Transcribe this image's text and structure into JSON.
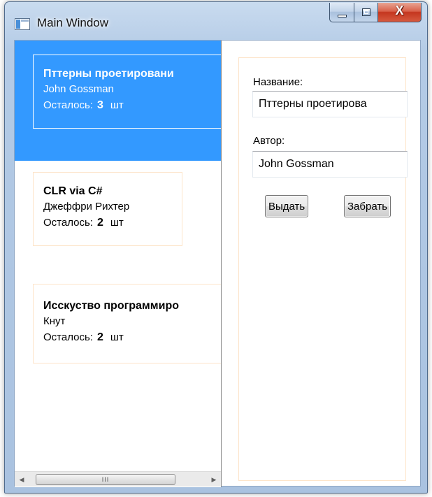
{
  "window": {
    "title": "Main Window",
    "close_glyph": "X"
  },
  "books": [
    {
      "title": "Пттерны проетировани",
      "author": "John Gossman",
      "remaining_label": "Осталось:",
      "count": "3",
      "unit": "шт",
      "selected": true
    },
    {
      "title": "CLR via C#",
      "author": "Джеффри Рихтер",
      "remaining_label": "Осталось:",
      "count": "2",
      "unit": "шт",
      "selected": false
    },
    {
      "title": "Исскуство программиро",
      "author": "Кнут",
      "remaining_label": "Осталось:",
      "count": "2",
      "unit": "шт",
      "selected": false
    }
  ],
  "scrollbar": {
    "left_arrow": "◀",
    "right_arrow": "▶",
    "grip": "III"
  },
  "detail": {
    "name_label": "Название:",
    "name_value": "Пттерны проетирова",
    "author_label": "Автор:",
    "author_value": "John Gossman",
    "issue_button": "Выдать",
    "take_button": "Забрать"
  }
}
